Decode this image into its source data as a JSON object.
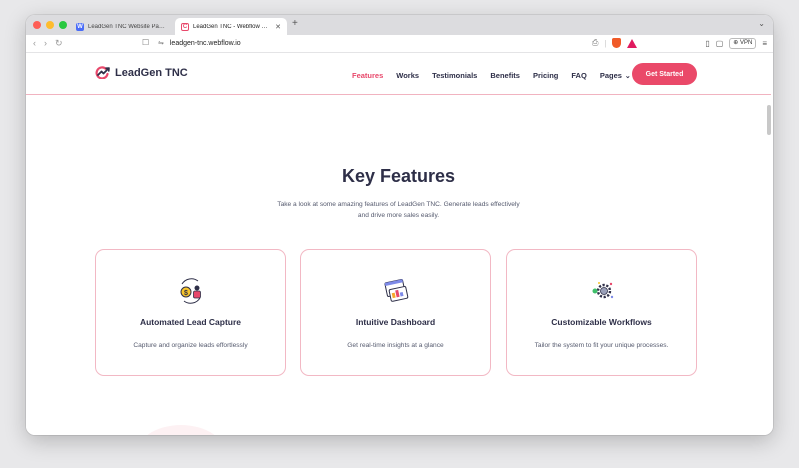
{
  "browser": {
    "tabs": [
      {
        "title": "LeadGen TNC Website Page Temp",
        "favicon": "W",
        "active": false
      },
      {
        "title": "LeadGen TNC - Webflow HTM",
        "favicon": "C",
        "active": true
      }
    ],
    "url": "leadgen-tnc.webflow.io",
    "vpn_label": "VPN"
  },
  "site": {
    "logo_text": "LeadGen TNC",
    "nav": [
      {
        "label": "Features",
        "current": true
      },
      {
        "label": "Works",
        "current": false
      },
      {
        "label": "Testimonials",
        "current": false
      },
      {
        "label": "Benefits",
        "current": false
      },
      {
        "label": "Pricing",
        "current": false
      },
      {
        "label": "FAQ",
        "current": false
      }
    ],
    "pages_label": "Pages",
    "cta_label": "Get Started"
  },
  "features": {
    "heading": "Key Features",
    "subheading": "Take a look at some amazing features of LeadGen TNC. Generate leads effectively and drive more sales easily.",
    "cards": [
      {
        "icon": "lead-capture-icon",
        "title": "Automated Lead Capture",
        "description": "Capture and organize leads effortlessly"
      },
      {
        "icon": "dashboard-icon",
        "title": "Intuitive Dashboard",
        "description": "Get real-time insights at a glance"
      },
      {
        "icon": "workflow-gear-icon",
        "title": "Customizable Workflows",
        "description": "Tailor the system to fit your unique processes."
      }
    ]
  },
  "colors": {
    "accent": "#ea4969",
    "heading": "#2e2f48",
    "card_border": "#f2b8c4"
  }
}
